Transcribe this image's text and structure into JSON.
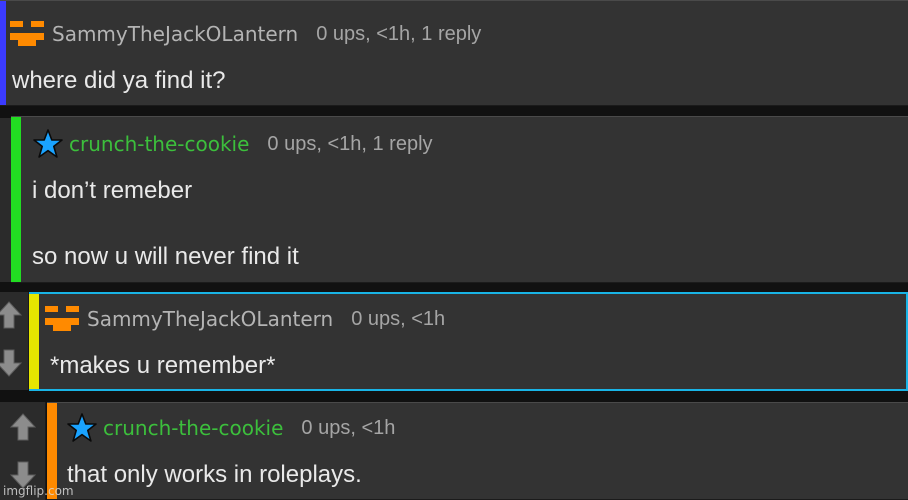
{
  "comments": [
    {
      "username": "SammyTheJackOLantern",
      "meta": "0 ups, <1h, 1 reply",
      "lines": [
        "where did ya find it?"
      ],
      "icon": "jack-o-lantern-icon",
      "nest_color": "#3b3bff"
    },
    {
      "username": "crunch-the-cookie",
      "meta": "0 ups, <1h, 1 reply",
      "lines": [
        "i don’t remeber",
        "so now u will never find it"
      ],
      "icon": "star-icon",
      "nest_color": "#22dd22"
    },
    {
      "username": "SammyTheJackOLantern",
      "meta": "0 ups, <1h",
      "lines": [
        "*makes u remember*"
      ],
      "icon": "jack-o-lantern-icon",
      "nest_color": "#e6e600",
      "highlight_color": "#19b4e6"
    },
    {
      "username": "crunch-the-cookie",
      "meta": "0 ups, <1h",
      "lines": [
        "that only works in roleplays."
      ],
      "icon": "star-icon",
      "nest_color": "#ff8a00"
    }
  ],
  "colors": {
    "page_bg": "#111111",
    "comment_bg": "#333333",
    "username_orange_user": "#b4b4b4",
    "username_green_user": "#3cbf3c",
    "meta_text": "#a5a5a5",
    "body_text": "#e9e9e9"
  },
  "watermark": "imgflip.com"
}
